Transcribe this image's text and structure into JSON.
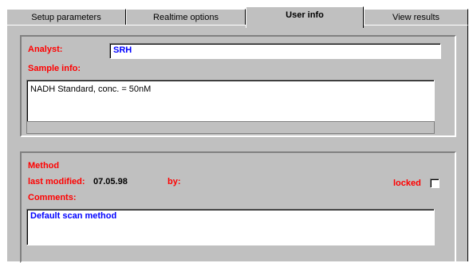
{
  "tabs": [
    {
      "label": "Setup parameters"
    },
    {
      "label": "Realtime options"
    },
    {
      "label": "User info"
    },
    {
      "label": "View results"
    }
  ],
  "user": {
    "analyst_label": "Analyst:",
    "analyst_value": "SRH",
    "sample_info_label": "Sample info:",
    "sample_info_value": "NADH Standard, conc. = 50nM"
  },
  "method": {
    "title": "Method",
    "last_modified_label": "last modified:",
    "last_modified_value": "07.05.98",
    "by_label": "by:",
    "by_value": "",
    "locked_label": "locked",
    "locked_checked": false,
    "comments_label": "Comments:",
    "comments_value": "Default scan method"
  },
  "colors": {
    "label": "#ff0000",
    "value_text": "#0000ff",
    "panel": "#c0c0c0"
  }
}
